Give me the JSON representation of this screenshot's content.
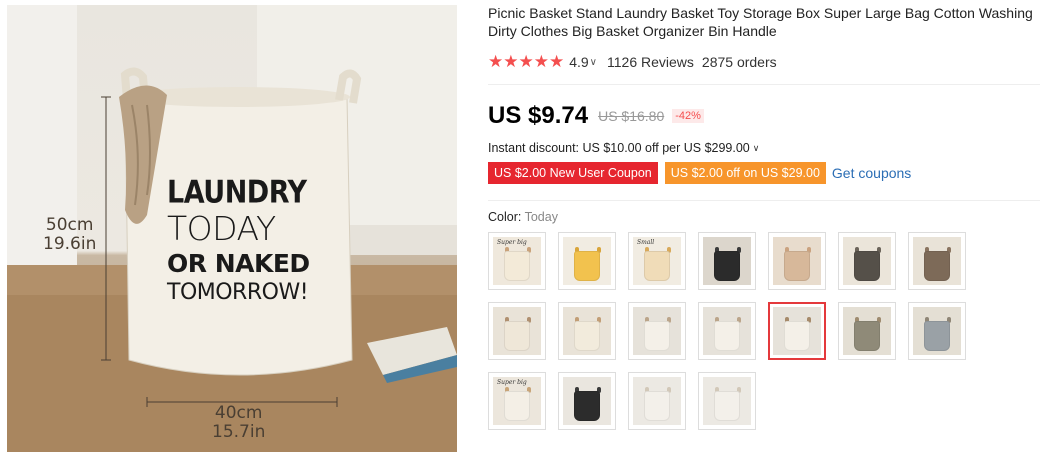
{
  "product": {
    "title": "Picnic Basket Stand Laundry Basket Toy Storage Box Super Large Bag Cotton Washing Dirty Clothes Big Basket Organizer Bin Handle",
    "rating": {
      "stars": "★★★★★",
      "score": "4.9",
      "caret": "∨",
      "reviews": "1126 Reviews",
      "orders": "2875 orders"
    },
    "price": {
      "current": "US $9.74",
      "original": "US $16.80",
      "discount": "-42%"
    },
    "instant_discount": {
      "text": "Instant discount: US $10.00 off per US $299.00",
      "caret": "∨"
    },
    "coupons": {
      "new_user": "US $2.00 New User Coupon",
      "store": "US $2.00 off on US $29.00",
      "get_link": "Get coupons"
    },
    "color": {
      "label": "Color:",
      "selected": "Today"
    }
  },
  "image": {
    "height_label_cm": "50cm",
    "height_label_in": "19.6in",
    "width_label_cm": "40cm",
    "width_label_in": "15.7in",
    "print_line1": "LAUNDRY",
    "print_line2": "TODAY",
    "print_line3": "OR NAKED",
    "print_line4": "TOMORROW!"
  },
  "swatches": [
    {
      "bg": "#efe8dc",
      "bag": "#f3ead8",
      "handle": "#c9a27a",
      "text": "Super big",
      "selected": false
    },
    {
      "bg": "#f1ece2",
      "bag": "#f2c24e",
      "handle": "#d9a53a",
      "text": "",
      "selected": false
    },
    {
      "bg": "#f1ece2",
      "bag": "#f0dcb8",
      "handle": "#d8a95a",
      "text": "Small",
      "selected": false
    },
    {
      "bg": "#dcd6cc",
      "bag": "#2b2b2b",
      "handle": "#3a3a3a",
      "text": "",
      "selected": false
    },
    {
      "bg": "#e8dccd",
      "bag": "#d7b89a",
      "handle": "#caa27f",
      "text": "",
      "selected": false
    },
    {
      "bg": "#ebe5da",
      "bag": "#555049",
      "handle": "#6b645a",
      "text": "",
      "selected": false
    },
    {
      "bg": "#e9e3d8",
      "bag": "#7d6a58",
      "handle": "#8a7460",
      "text": "",
      "selected": false
    },
    {
      "bg": "#e9e3d8",
      "bag": "#efe7d8",
      "handle": "#b09070",
      "text": "",
      "selected": false
    },
    {
      "bg": "#e9e3d8",
      "bag": "#f2ebdc",
      "handle": "#c29e76",
      "text": "",
      "selected": false
    },
    {
      "bg": "#e6e2da",
      "bag": "#f4f0e8",
      "handle": "#bba58a",
      "text": "",
      "selected": false
    },
    {
      "bg": "#e6e2da",
      "bag": "#f4f0e8",
      "handle": "#bba58a",
      "text": "",
      "selected": false
    },
    {
      "bg": "#e6e2da",
      "bag": "#f4f0e8",
      "handle": "#a68a6a",
      "text": "",
      "selected": true
    },
    {
      "bg": "#e4dfd4",
      "bag": "#8f8a78",
      "handle": "#9e8b6f",
      "text": "",
      "selected": false
    },
    {
      "bg": "#e4dfd4",
      "bag": "#9aa1a6",
      "handle": "#8f8676",
      "text": "",
      "selected": false
    },
    {
      "bg": "#ece6dc",
      "bag": "#f4efe6",
      "handle": "#c8a478",
      "text": "Super big",
      "selected": false
    },
    {
      "bg": "#eae6df",
      "bag": "#2c2c2c",
      "handle": "#3a3a3a",
      "text": "",
      "selected": false
    },
    {
      "bg": "#ece9e3",
      "bag": "#f3f0ea",
      "handle": "#d2c8b8",
      "text": "",
      "selected": false
    },
    {
      "bg": "#ece9e3",
      "bag": "#f3f0ea",
      "handle": "#d2c8b8",
      "text": "",
      "selected": false
    }
  ]
}
